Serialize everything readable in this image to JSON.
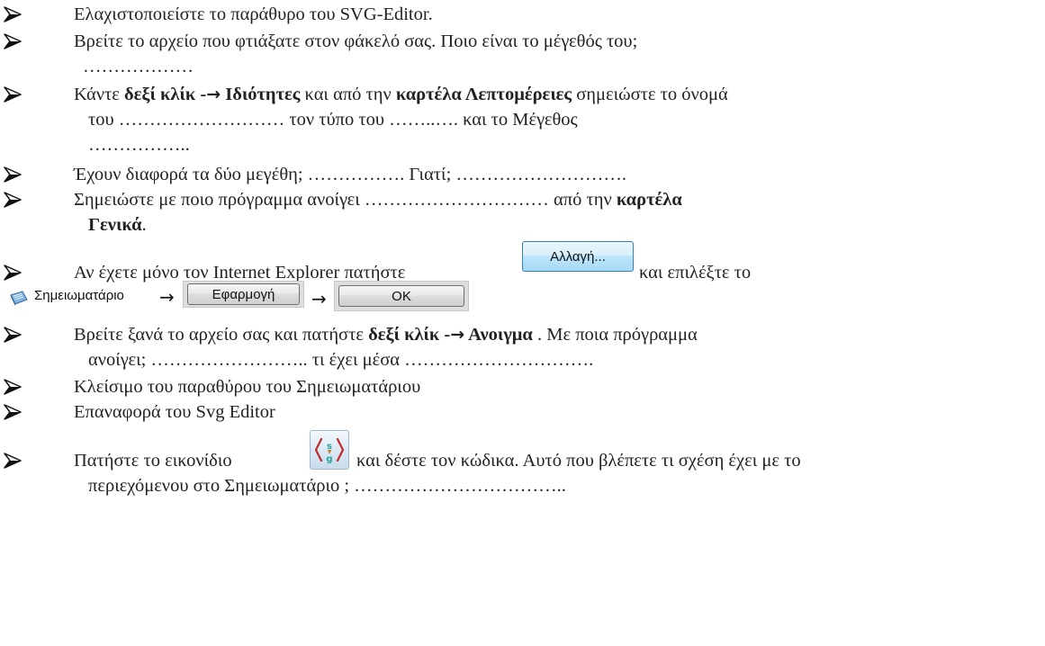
{
  "steps": [
    {
      "text": "Ελαχιστοποιείστε το παράθυρο του SVG-Editor."
    },
    {
      "text": "Βρείτε το αρχείο  που φτιάξατε στον φάκελό σας. Ποιο είναι το μέγεθός του;",
      "cont": "………………"
    },
    {
      "a": "Κάντε ",
      "b1": "δεξί κλίκ -",
      "arrow": "→",
      "b2": " Ιδιότητες",
      "c": " και από την ",
      "b3": "καρτέλα Λεπτομέρειες",
      "d": " σημειώστε το όνομά",
      "cont1": "του ………………………  τον τύπο του ……..…. και το Μέγεθος",
      "cont2": "…………….."
    },
    {
      "text": "Έχουν διαφορά τα δύο μεγέθη; …………….  Γιατί; ………………………."
    },
    {
      "a": "Σημειώστε με ποιο πρόγραμμα ανοίγει ………………………… από την ",
      "b": "καρτέλα",
      "cont_b": "Γενικά",
      "cont_end": "."
    },
    {
      "a": "Αν έχετε μόνο τον Internet Explorer πατήστε",
      "c": "και επιλέξτε το"
    },
    {
      "a": "Βρείτε ξανά το αρχείο σας και πατήστε ",
      "b1": "δεξί κλίκ -",
      "arrow": "→",
      "b2": " Ανοιγμα",
      "c": " . Με ποια πρόγραμμα",
      "cont": "ανοίγει; …………………….. τι έχει μέσα …………………………."
    },
    {
      "text": "Κλείσιμο του παραθύρου του Σημειωματάριου"
    },
    {
      "text": "Επαναφορά του Svg Editor"
    },
    {
      "a": "Πατήστε το εικονίδιο",
      "c": "και δέστε τον κώδικα. Αυτό που βλέπετε τι σχέση έχει με το",
      "cont": "περιεχόμενου στο Σημειωματάριο ; …………………………….."
    }
  ],
  "buttons": {
    "change": "Αλλαγή...",
    "notepad": "Σημειωματάριο",
    "apply": "Εφαρμογή",
    "ok": "OK",
    "flow_arrow": "→"
  },
  "icons": {
    "bullet": "arrowhead-bullet-icon",
    "notepad": "notepad-icon",
    "svg_code": "svg-code-icon",
    "svg_code_glyph": "s\ng"
  }
}
